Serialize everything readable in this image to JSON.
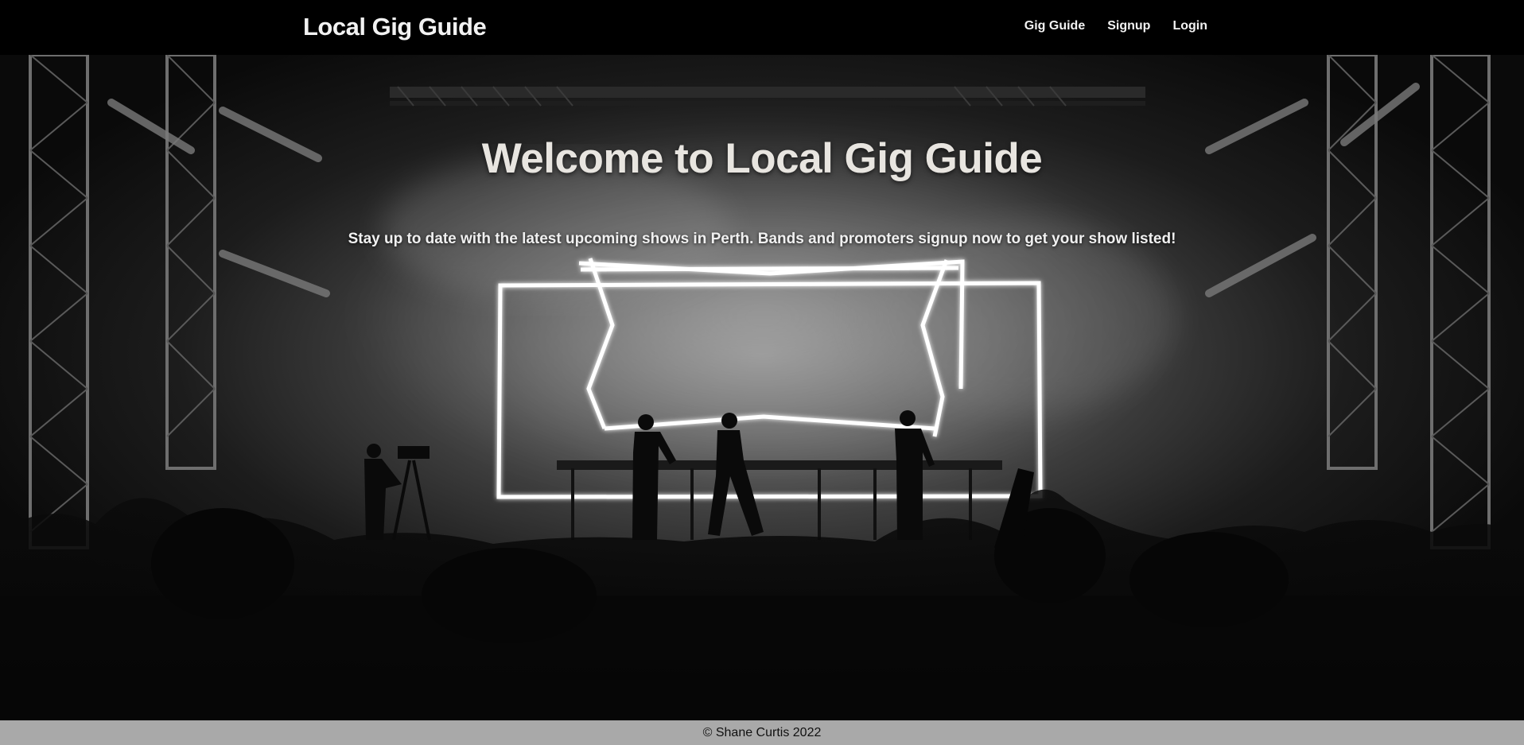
{
  "navbar": {
    "brand": "Local Gig Guide",
    "links": [
      {
        "label": "Gig Guide"
      },
      {
        "label": "Signup"
      },
      {
        "label": "Login"
      }
    ]
  },
  "hero": {
    "title": "Welcome to Local Gig Guide",
    "subtitle": "Stay up to date with the latest upcoming shows in Perth. Bands and promoters signup now to get your show listed!",
    "background_image": "black-and-white concert stage with neon frame, performers and crowd silhouettes"
  },
  "footer": {
    "copyright": "© Shane Curtis 2022"
  },
  "colors": {
    "navbar_bg": "#000000",
    "text_light": "#f2f2f2",
    "footer_bg": "#a9a9a9"
  }
}
